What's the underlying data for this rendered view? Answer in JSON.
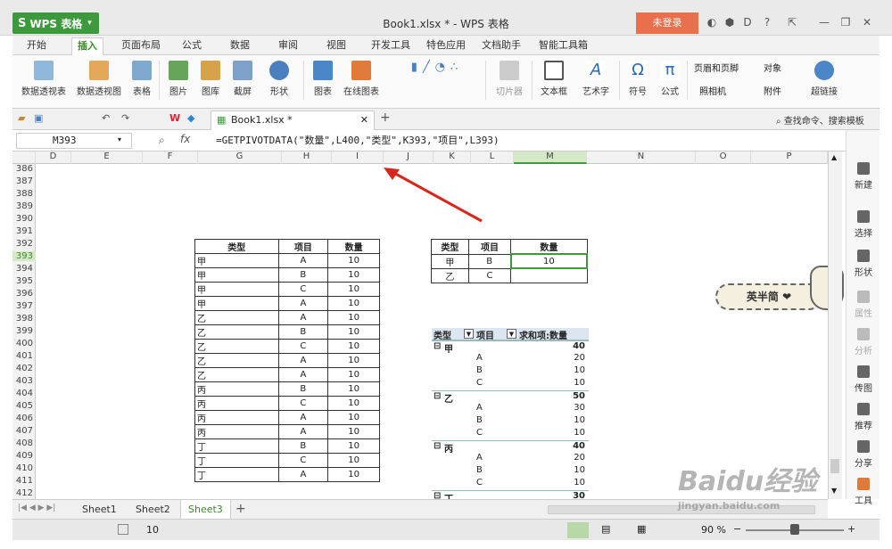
{
  "titlebar": {
    "app_name": "WPS 表格",
    "window_title": "Book1.xlsx * - WPS 表格",
    "login": "未登录"
  },
  "tabs": [
    "开始",
    "插入",
    "页面布局",
    "公式",
    "数据",
    "审阅",
    "视图",
    "开发工具",
    "特色应用",
    "文档助手",
    "智能工具箱"
  ],
  "active_tab": "插入",
  "ribbon": {
    "items": [
      "数据透视表",
      "数据透视图",
      "表格",
      "图片",
      "图库",
      "截屏",
      "形状",
      "图表",
      "在线图表",
      "切片器",
      "文本框",
      "艺术字",
      "符号",
      "公式",
      "页眉和页脚",
      "照相机",
      "对象",
      "附件",
      "超链接"
    ]
  },
  "docbar": {
    "filename": "Book1.xlsx *",
    "search": "查找命令、搜索模板"
  },
  "formula": {
    "cell": "M393",
    "fx": "fx",
    "text": "=GETPIVOTDATA(\"数量\",L400,\"类型\",K393,\"项目\",L393)"
  },
  "columns": [
    "D",
    "E",
    "F",
    "G",
    "H",
    "I",
    "J",
    "K",
    "L",
    "M",
    "N",
    "O",
    "P"
  ],
  "selected_col": "M",
  "rows": [
    "386",
    "387",
    "388",
    "389",
    "390",
    "391",
    "392",
    "393",
    "394",
    "395",
    "396",
    "397",
    "398",
    "399",
    "400",
    "401",
    "402",
    "403",
    "404",
    "405",
    "406",
    "407",
    "408",
    "409",
    "410",
    "411",
    "412"
  ],
  "selected_row": "393",
  "source_table": {
    "headers": [
      "类型",
      "项目",
      "数量"
    ],
    "rows": [
      [
        "甲",
        "A",
        "10"
      ],
      [
        "甲",
        "B",
        "10"
      ],
      [
        "甲",
        "C",
        "10"
      ],
      [
        "甲",
        "A",
        "10"
      ],
      [
        "乙",
        "A",
        "10"
      ],
      [
        "乙",
        "B",
        "10"
      ],
      [
        "乙",
        "C",
        "10"
      ],
      [
        "乙",
        "A",
        "10"
      ],
      [
        "乙",
        "A",
        "10"
      ],
      [
        "丙",
        "B",
        "10"
      ],
      [
        "丙",
        "C",
        "10"
      ],
      [
        "丙",
        "A",
        "10"
      ],
      [
        "丙",
        "A",
        "10"
      ],
      [
        "丁",
        "B",
        "10"
      ],
      [
        "丁",
        "C",
        "10"
      ],
      [
        "丁",
        "A",
        "10"
      ]
    ]
  },
  "lookup_table": {
    "headers": [
      "类型",
      "项目",
      "数量"
    ],
    "rows": [
      [
        "甲",
        "B",
        "10"
      ],
      [
        "乙",
        "C",
        ""
      ]
    ]
  },
  "pivot": {
    "headers": [
      "类型",
      "项目",
      "求和项:数量"
    ],
    "groups": [
      {
        "name": "甲",
        "total": "40",
        "items": [
          [
            "A",
            "20"
          ],
          [
            "B",
            "10"
          ],
          [
            "C",
            "10"
          ]
        ]
      },
      {
        "name": "乙",
        "total": "50",
        "items": [
          [
            "A",
            "30"
          ],
          [
            "B",
            "10"
          ],
          [
            "C",
            "10"
          ]
        ]
      },
      {
        "name": "丙",
        "total": "40",
        "items": [
          [
            "A",
            "20"
          ],
          [
            "B",
            "10"
          ],
          [
            "C",
            "10"
          ]
        ]
      },
      {
        "name": "丁",
        "total": "30",
        "items": []
      }
    ]
  },
  "sidepanel": [
    "新建",
    "选择",
    "形状",
    "属性",
    "分析",
    "传图",
    "推荐",
    "分享",
    "工具"
  ],
  "sheets": [
    "Sheet1",
    "Sheet2",
    "Sheet3"
  ],
  "active_sheet": "Sheet3",
  "status": {
    "value": "10",
    "zoom": "90 %"
  },
  "sticker_text": "英半简",
  "watermark": {
    "line1": "Baidu经验",
    "line2": "jingyan.baidu.com"
  }
}
